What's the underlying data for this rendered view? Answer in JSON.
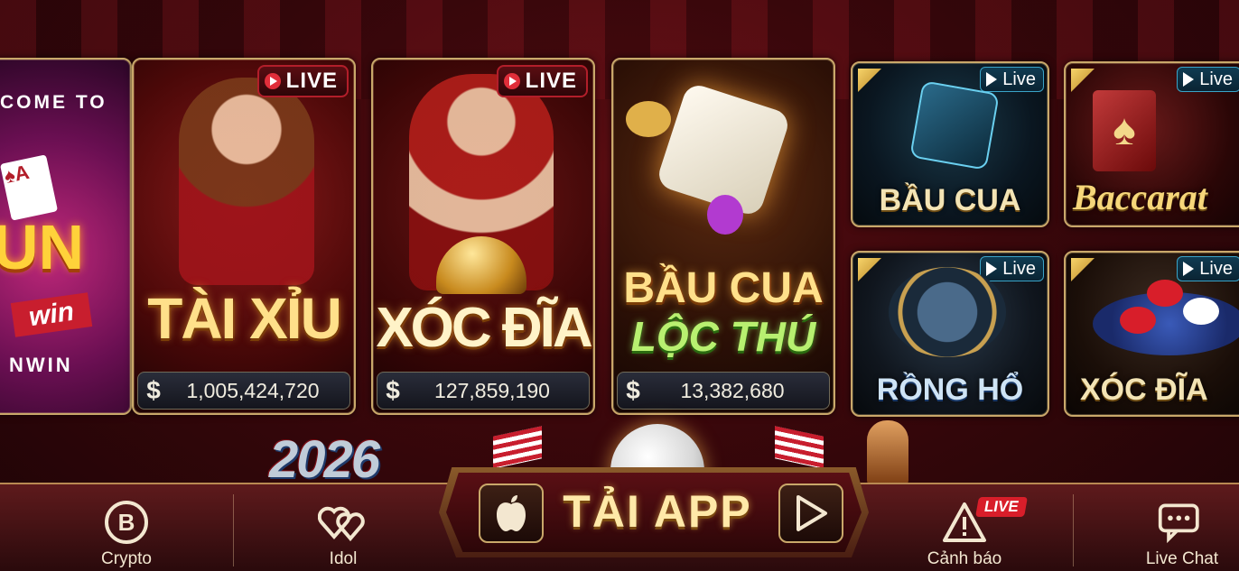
{
  "promo_card": {
    "welcome_text": "COME TO",
    "brand_text": "UN",
    "brand_sub": "win",
    "footer_text": "NWIN"
  },
  "games_big": [
    {
      "title": "TÀI XỈU",
      "live": "LIVE",
      "jackpot_symbol": "$",
      "jackpot": "1,005,424,720"
    },
    {
      "title": "XÓC ĐĨA",
      "live": "LIVE",
      "jackpot_symbol": "$",
      "jackpot": "127,859,190"
    },
    {
      "title_line1": "BẦU CUA",
      "title_line2": "LỘC THÚ",
      "jackpot_symbol": "$",
      "jackpot": "13,382,680"
    }
  ],
  "games_small": [
    {
      "title": "BẦU CUA",
      "live": "Live"
    },
    {
      "title": "Baccarat",
      "live": "Live"
    },
    {
      "title": "RỒNG HỔ",
      "live": "Live"
    },
    {
      "title": "XÓC ĐĨA",
      "live": "Live"
    }
  ],
  "decor": {
    "year": "2026"
  },
  "bottom_nav": {
    "crypto": "Crypto",
    "idol": "Idol",
    "canh_bao": "Cảnh báo",
    "canh_bao_badge": "LIVE",
    "live_chat": "Live Chat"
  },
  "app_bar": {
    "label": "TẢI APP"
  },
  "colors": {
    "gold": "#ffe08a",
    "live_red": "#e02e3a",
    "live_blue": "#3aa4c8",
    "background": "#3a070b"
  }
}
